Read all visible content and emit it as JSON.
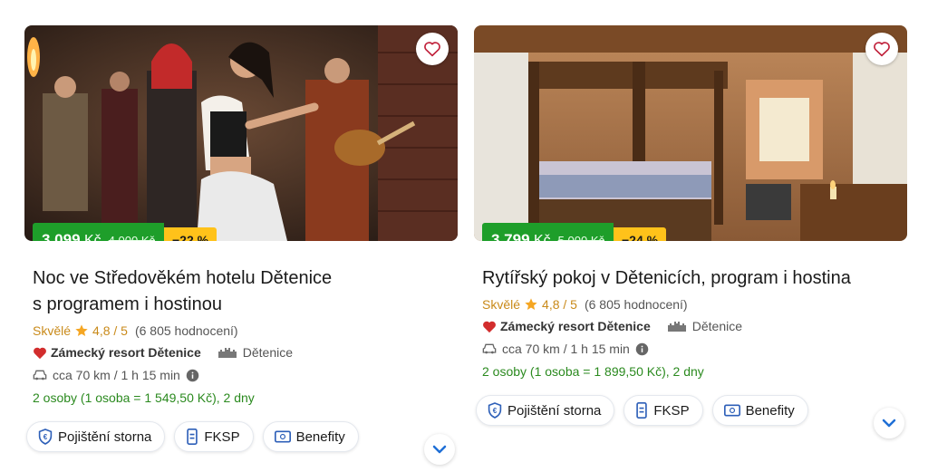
{
  "cards": [
    {
      "title_line1": "Noc ve Středověkém hotelu Dětenice",
      "title_line2": "s programem i hostinou",
      "price_now": "3 099",
      "currency": "Kč",
      "price_old": "4 000 Kč",
      "discount": "−22 %",
      "rating_word": "Skvělé",
      "rating_score": "4,8 / 5",
      "reviews": "(6 805 hodnocení)",
      "resort": "Zámecký resort Dětenice",
      "place": "Dětenice",
      "distance": "cca 70 km / 1 h 15 min",
      "persons": "2 osoby (1 osoba = 1 549,50 Kč), 2 dny",
      "chips": [
        "Pojištění storna",
        "FKSP",
        "Benefity"
      ]
    },
    {
      "title_line1": "Rytířský pokoj v Dětenicích, program i hostina",
      "title_line2": "",
      "price_now": "3 799",
      "currency": "Kč",
      "price_old": "5 000 Kč",
      "discount": "−24 %",
      "rating_word": "Skvělé",
      "rating_score": "4,8 / 5",
      "reviews": "(6 805 hodnocení)",
      "resort": "Zámecký resort Dětenice",
      "place": "Dětenice",
      "distance": "cca 70 km / 1 h 15 min",
      "persons": "2 osoby (1 osoba = 1 899,50 Kč), 2 dny",
      "chips": [
        "Pojištění storna",
        "FKSP",
        "Benefity"
      ]
    }
  ],
  "colors": {
    "price_green": "#1e9e2a",
    "discount_yellow": "#ffc21a",
    "rating_orange": "#c98a1a",
    "persons_green": "#2b8a1f",
    "heart_red": "#d22d2d",
    "chevron_blue": "#1f6fd6"
  },
  "icons": [
    "heart-outline-icon",
    "star-icon",
    "heart-filled-icon",
    "castle-icon",
    "car-icon",
    "info-icon",
    "shield-icon",
    "voucher-icon",
    "card-icon",
    "chevron-down-icon"
  ]
}
